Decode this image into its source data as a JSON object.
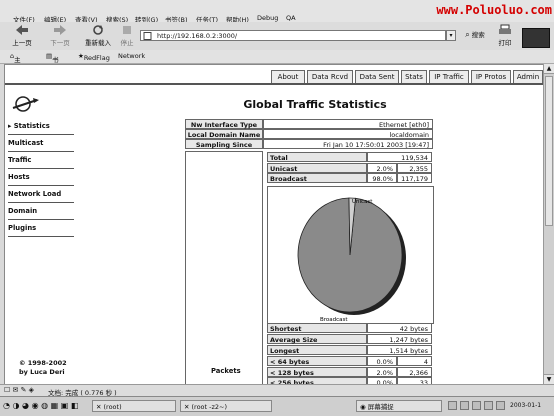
{
  "watermark": "www.Poluoluo.com",
  "menu": [
    "文件(F)",
    "编辑(E)",
    "查看(V)",
    "搜索(S)",
    "转到(G)",
    "书签(B)",
    "任务(T)",
    "帮助(H)",
    "Debug",
    "QA"
  ],
  "toolbar": {
    "back": "上一页",
    "forward": "下一页",
    "reload": "重新载入",
    "stop": "停止",
    "url": "http://192.168.0.2:3000/",
    "search": "搜索",
    "print": "打印"
  },
  "bookmarks": [
    "主页",
    "书签",
    "RedFlag",
    "Network"
  ],
  "tabs": [
    "About",
    "Data Rcvd",
    "Data Sent",
    "Stats",
    "IP Traffic",
    "IP Protos",
    "Admin"
  ],
  "sidebar": [
    "Statistics",
    "Multicast",
    "Traffic",
    "Hosts",
    "Network Load",
    "Domain",
    "Plugins"
  ],
  "title": "Global Traffic Statistics",
  "info": [
    {
      "label": "Nw Interface Type",
      "value": "Ethernet [eth0]"
    },
    {
      "label": "Local Domain Name",
      "value": "localdomain"
    },
    {
      "label": "Sampling Since",
      "value": "Fri Jan 10 17:50:01 2003 [19:47]"
    }
  ],
  "traffic": [
    {
      "label": "Total",
      "pct": "",
      "value": "119,534"
    },
    {
      "label": "Unicast",
      "pct": "2.0%",
      "value": "2,355"
    },
    {
      "label": "Broadcast",
      "pct": "98.0%",
      "value": "117,179"
    }
  ],
  "pie": {
    "unicast_label": "Unicast",
    "broadcast_label": "Broadcast",
    "unicast_fraction": 0.02,
    "colors": {
      "slice": "#8a8a8a",
      "shadow": "#222222"
    }
  },
  "packets_label": "Packets",
  "sizes": [
    {
      "label": "Shortest",
      "pct": "",
      "value": "42 bytes"
    },
    {
      "label": "Average Size",
      "pct": "",
      "value": "1,247 bytes"
    },
    {
      "label": "Longest",
      "pct": "",
      "value": "1,514 bytes"
    },
    {
      "label": "< 64 bytes",
      "pct": "0.0%",
      "value": "4"
    },
    {
      "label": "< 128 bytes",
      "pct": "2.0%",
      "value": "2,366"
    },
    {
      "label": "< 256 bytes",
      "pct": "0.0%",
      "value": "33"
    }
  ],
  "footer": [
    "© 1998-2002",
    "by Luca Deri"
  ],
  "status": "文档: 完成 ( 0.776 秒 )",
  "taskbar": {
    "t1": "(root)",
    "t2": "(root -z2~)",
    "t3": "屏幕捕捉",
    "clock": "2003-01-1"
  }
}
